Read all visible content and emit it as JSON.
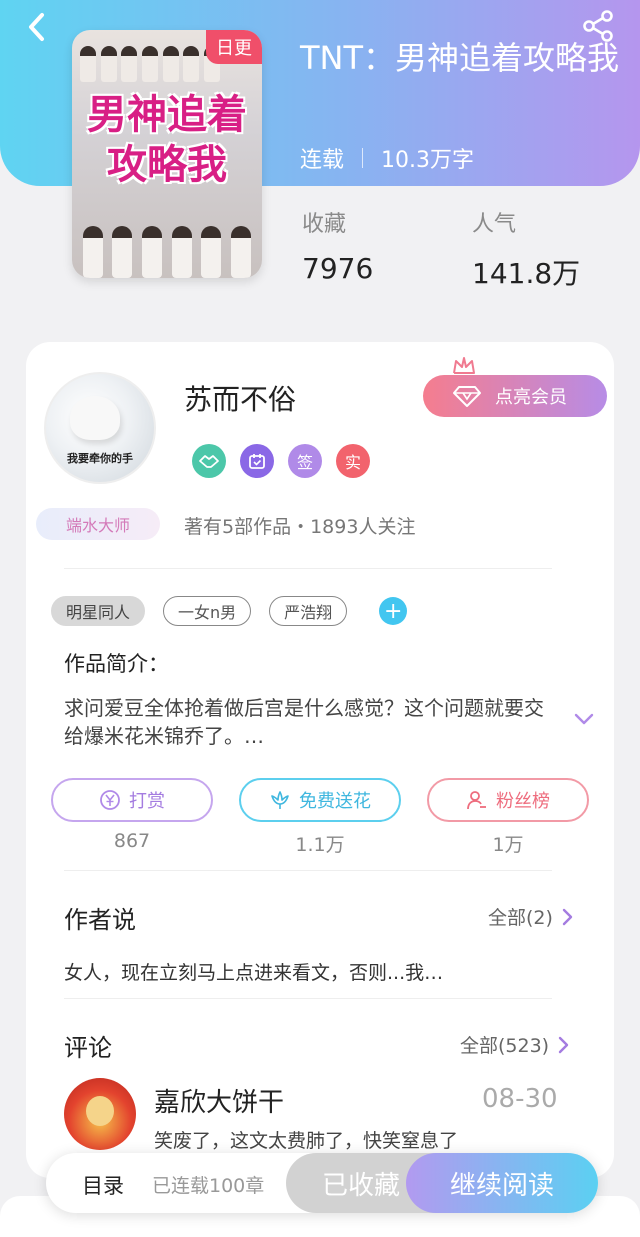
{
  "colors": {
    "accent_cyan": "#42c6f0",
    "accent_purple": "#b596ee",
    "accent_pink": "#f57d8e"
  },
  "header": {
    "back_icon": "back-arrow-icon",
    "share_icon": "share-icon"
  },
  "book": {
    "cover_badge": "日更",
    "cover_title_line1": "男神追着",
    "cover_title_line2": "攻略我",
    "title": "TNT：男神追着攻略我",
    "status": "连载",
    "word_count": "10.3万字",
    "stats": [
      {
        "label": "收藏",
        "value": "7976"
      },
      {
        "label": "人气",
        "value": "141.8万"
      }
    ]
  },
  "author": {
    "avatar_caption": "我要牵你的手",
    "name": "苏而不俗",
    "vip_button": "点亮会员",
    "badges": [
      "签",
      "实"
    ],
    "title_badge": "端水大师",
    "summary": "著有5部作品・1893人关注"
  },
  "tags": [
    "明星同人",
    "一女n男",
    "严浩翔"
  ],
  "intro": {
    "heading": "作品简介：",
    "text": "求问爱豆全体抢着做后宫是什么感觉？这个问题就要交给爆米花米锦乔了。…"
  },
  "actions": [
    {
      "label": "打赏",
      "count": "867",
      "icon": "yuan-coin-icon"
    },
    {
      "label": "免费送花",
      "count": "1.1万",
      "icon": "flower-icon"
    },
    {
      "label": "粉丝榜",
      "count": "1万",
      "icon": "fans-person-icon"
    }
  ],
  "author_says": {
    "heading": "作者说",
    "all_label": "全部(2)",
    "text": "女人，现在立刻马上点进来看文，否则...我…"
  },
  "comments": {
    "heading": "评论",
    "all_label": "全部(523)",
    "items": [
      {
        "user": "嘉欣大饼干",
        "date": "08-30",
        "text": "笑废了，这文太费肺了，快笑窒息了"
      }
    ]
  },
  "bottom_bar": {
    "toc": "目录",
    "chapters": "已连载100章",
    "favorited": "已收藏",
    "continue": "继续阅读"
  }
}
